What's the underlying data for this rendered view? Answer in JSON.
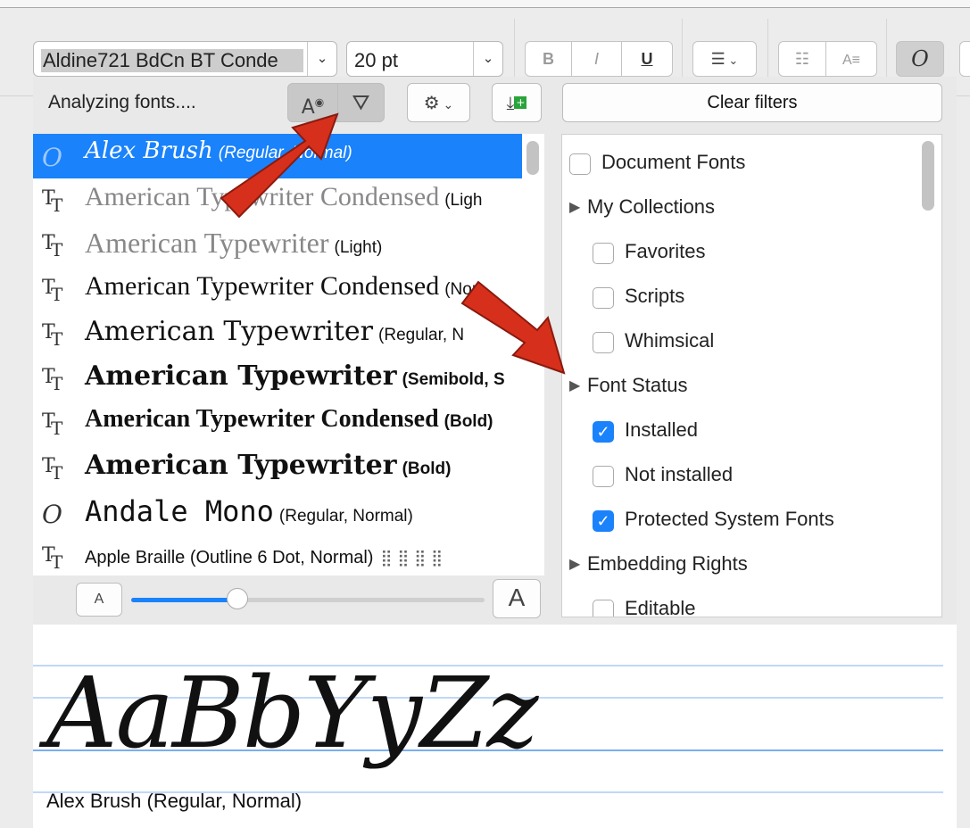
{
  "toolbar": {
    "font_name": "Aldine721 BdCn BT Conde",
    "font_size": "20 pt",
    "bold_label": "B",
    "italic_label": "I",
    "underline_label": "U",
    "font_icon_label": "O"
  },
  "panel": {
    "status_text": "Analyzing fonts....",
    "clear_filters_label": "Clear filters"
  },
  "fonts": [
    {
      "icon": "opentype-icon",
      "name": "Alex Brush",
      "style": "(Regular, Normal)",
      "selected": true
    },
    {
      "icon": "truetype-icon",
      "name": "American Typewriter Condensed",
      "style": "(Ligh"
    },
    {
      "icon": "truetype-icon",
      "name": "American Typewriter",
      "style": "(Light)"
    },
    {
      "icon": "truetype-icon",
      "name": "American Typewriter Condensed",
      "style": "(Nor"
    },
    {
      "icon": "truetype-icon",
      "name": "American Typewriter",
      "style": "(Regular, N"
    },
    {
      "icon": "truetype-icon",
      "name": "American Typewriter",
      "style": "(Semibold, S"
    },
    {
      "icon": "truetype-icon",
      "name": "American Typewriter Condensed",
      "style": "(Bold)"
    },
    {
      "icon": "truetype-icon",
      "name": "American Typewriter",
      "style": "(Bold)"
    },
    {
      "icon": "opentype-icon",
      "name": "Andale Mono",
      "style": "(Regular, Normal)"
    },
    {
      "icon": "truetype-icon",
      "name": "Apple Braille (Outline 6 Dot, Normal)",
      "style": ""
    }
  ],
  "size_slider": {
    "small_label": "A",
    "large_label": "A",
    "level": 0.3
  },
  "filters": [
    {
      "type": "checkbox",
      "label": "Document Fonts",
      "checked": false,
      "indent": 0
    },
    {
      "type": "group",
      "label": "My Collections",
      "indent": 0
    },
    {
      "type": "checkbox",
      "label": "Favorites",
      "checked": false,
      "indent": 1
    },
    {
      "type": "checkbox",
      "label": "Scripts",
      "checked": false,
      "indent": 1
    },
    {
      "type": "checkbox",
      "label": "Whimsical",
      "checked": false,
      "indent": 1
    },
    {
      "type": "group",
      "label": "Font Status",
      "indent": 0
    },
    {
      "type": "checkbox",
      "label": "Installed",
      "checked": true,
      "indent": 1
    },
    {
      "type": "checkbox",
      "label": "Not installed",
      "checked": false,
      "indent": 1
    },
    {
      "type": "checkbox",
      "label": "Protected System Fonts",
      "checked": true,
      "indent": 1
    },
    {
      "type": "group",
      "label": "Embedding Rights",
      "indent": 0
    },
    {
      "type": "checkbox",
      "label": "Editable",
      "checked": false,
      "indent": 1
    }
  ],
  "preview": {
    "sample_text": "AaBbYyZz",
    "font_label": "Alex Brush (Regular, Normal)"
  },
  "colors": {
    "accent": "#1a82fb",
    "arrow": "#d6301c"
  }
}
